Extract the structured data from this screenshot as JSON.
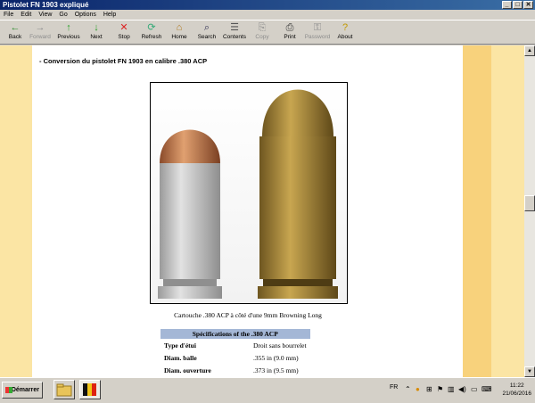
{
  "window": {
    "title": "Pistolet FN 1903 expliqué"
  },
  "window_buttons": [
    "_",
    "□",
    "✕"
  ],
  "menu": [
    "File",
    "Edit",
    "View",
    "Go",
    "Options",
    "Help"
  ],
  "toolbar": [
    {
      "label": "Back",
      "icon": "←",
      "enabled": true
    },
    {
      "label": "Forward",
      "icon": "→",
      "enabled": false
    },
    {
      "label": "Previous",
      "icon": "↑",
      "enabled": true
    },
    {
      "label": "Next",
      "icon": "↓",
      "enabled": true
    },
    {
      "label": "Stop",
      "icon": "✕",
      "enabled": true
    },
    {
      "label": "Refresh",
      "icon": "⟳",
      "enabled": true
    },
    {
      "label": "Home",
      "icon": "⌂",
      "enabled": true
    },
    {
      "label": "Search",
      "icon": "⌕",
      "enabled": true
    },
    {
      "label": "Contents",
      "icon": "☰",
      "enabled": true
    },
    {
      "label": "Copy",
      "icon": "⎘",
      "enabled": false
    },
    {
      "label": "Print",
      "icon": "⎙",
      "enabled": true
    },
    {
      "label": "Password",
      "icon": "⚿",
      "enabled": false
    },
    {
      "label": "About",
      "icon": "?",
      "enabled": true
    }
  ],
  "page": {
    "heading": "- Conversion du pistolet FN 1903 en calibre .380 ACP",
    "caption": "Cartouche .380 ACP à côté d'une 9mm Browning Long",
    "spec_title": "Spécifications of the .380 ACP",
    "spec_rows": [
      {
        "key": "Type d'étui",
        "value": "Droit sans bourrelet"
      },
      {
        "key": "Diam. balle",
        "value": ".355 in (9.0 mm)"
      },
      {
        "key": "Diam. ouverture",
        "value": ".373 in (9.5 mm)"
      }
    ]
  },
  "colors": {
    "sidebar": "#fbe5a4",
    "sidebar_stripe": "#f8d27c",
    "table_header": "#a4b7d6",
    "titlebar": "#0a246a"
  },
  "taskbar": {
    "start_label": "Démarrer",
    "language": "FR",
    "time": "11:22",
    "date": "21/06/2016"
  }
}
